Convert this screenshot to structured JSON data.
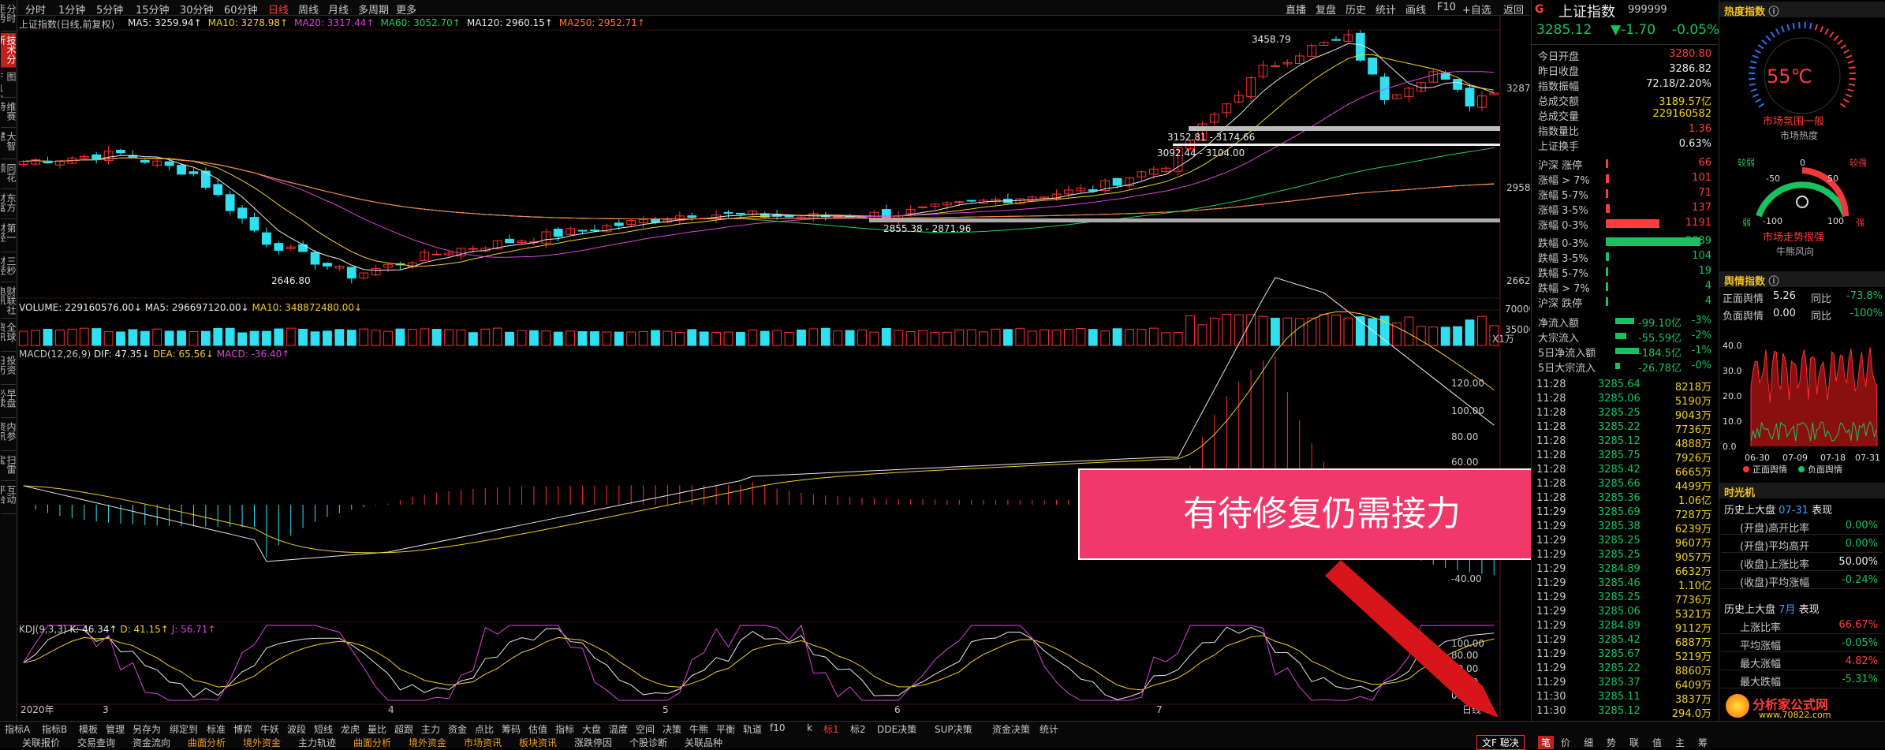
{
  "topbar": {
    "periods": [
      "分时",
      "1分钟",
      "5分钟",
      "15分钟",
      "30分钟",
      "60分钟",
      "日线",
      "周线",
      "月线",
      "多周期",
      "更多"
    ],
    "active": "日线",
    "right": [
      "直播",
      "复盘",
      "历史",
      "统计",
      "画线",
      "F10",
      "+自选",
      "返回"
    ]
  },
  "leftbar": {
    "tabs": [
      "分时走势",
      "技术分析",
      "图F10",
      "维赛特",
      "大智慧",
      "同花顺",
      "东方财富",
      "第一财经",
      "三秒财经",
      "财联社电讯",
      "全球资讯",
      "投资日历",
      "早盘必读",
      "内参资讯",
      "扫雷宝",
      "互动平台"
    ],
    "active": "技术分析"
  },
  "main": {
    "title": "上证指数(日线,前复权)",
    "ma": [
      {
        "t": "MA5: 3259.94↑",
        "c": "#e8e8e8"
      },
      {
        "t": "MA10: 3278.98↑",
        "c": "#f0d020"
      },
      {
        "t": "MA20: 3317.44↑",
        "c": "#e040e0"
      },
      {
        "t": "MA60: 3052.70↑",
        "c": "#20d060"
      },
      {
        "t": "MA120: 2960.15↑",
        "c": "#e8e8e8"
      },
      {
        "t": "MA250: 2952.71↑",
        "c": "#ff7a30"
      }
    ],
    "price_axis": [
      "3287",
      "2958",
      "2662"
    ],
    "annot": {
      "high": "3458.79",
      "low": "2646.80",
      "zone1": "3152.81 - 3174.66",
      "zone2": "3092.44 - 3104.00",
      "zone3": "2855.38 - 2871.96"
    },
    "volume": {
      "label": "VOLUME: 229160576.00↓",
      "ma5": "MA5: 296697120.00↓",
      "ma10": "MA10: 348872480.00↓",
      "axis": [
        "70000",
        "35000",
        "X1万"
      ]
    },
    "macd": {
      "label": "MACD(12,26,9)",
      "dif": "DIF: 47.35↓",
      "dea": "DEA: 65.56↓",
      "macd": "MACD: -36.40↑",
      "axis": [
        "120.00",
        "100.00",
        "80.00",
        "60.00",
        "-40.00"
      ]
    },
    "kdj": {
      "label": "KDJ(9,3,3)",
      "k": "K: 46.34↑",
      "d": "D: 41.15↑",
      "j": "J: 56.71↑",
      "axis": [
        "100.00",
        "80.00",
        "50.00",
        "20.00",
        "0.00"
      ]
    },
    "date_axis": [
      "2020年",
      "3",
      "4",
      "5",
      "6",
      "7"
    ],
    "date_right": "日线"
  },
  "banner": "有待修复仍需接力",
  "quote": {
    "mark": "G",
    "name": "上证指数",
    "code": "999999",
    "price": "3285.12",
    "change": "▼-1.70",
    "pct": "-0.05%"
  },
  "stats": [
    {
      "l": "今日开盘",
      "v": "3280.80",
      "c": "red"
    },
    {
      "l": "昨日收盘",
      "v": "3286.82",
      "c": "wht"
    },
    {
      "l": "指数振幅",
      "v": "72.18/2.20%",
      "c": "wht"
    },
    {
      "l": "总成交额",
      "v": "3189.57亿",
      "c": "yel"
    },
    {
      "l": "总成交量",
      "v": "229160582",
      "c": "yel"
    },
    {
      "l": "指数量比",
      "v": "1.36",
      "c": "red"
    },
    {
      "l": "上证换手",
      "v": "0.63%",
      "c": "wht"
    }
  ],
  "updown": [
    {
      "l": "沪深 涨停",
      "v": "66",
      "c": "red",
      "w": 0
    },
    {
      "l": "涨幅 > 7%",
      "v": "101",
      "c": "red",
      "w": 3
    },
    {
      "l": "涨幅 5-7%",
      "v": "71",
      "c": "red",
      "w": 2
    },
    {
      "l": "涨幅 3-5%",
      "v": "137",
      "c": "red",
      "w": 4
    },
    {
      "l": "涨幅 0-3%",
      "v": "1191",
      "c": "red",
      "w": 50
    },
    {
      "l": "跌幅 0-3%",
      "v": "2089",
      "c": "green",
      "w": 88
    },
    {
      "l": "跌幅 3-5%",
      "v": "104",
      "c": "green",
      "w": 3
    },
    {
      "l": "跌幅 5-7%",
      "v": "19",
      "c": "green",
      "w": 1
    },
    {
      "l": "跌幅 > 7%",
      "v": "4",
      "c": "green",
      "w": 1
    },
    {
      "l": "沪深 跌停",
      "v": "4",
      "c": "green",
      "w": 0
    }
  ],
  "flows": [
    {
      "l": "净流入额",
      "v": "-99.10亿",
      "p": "-3%"
    },
    {
      "l": "大宗流入",
      "v": "-55.59亿",
      "p": "-2%"
    },
    {
      "l": "5日净流入额",
      "v": "-184.5亿",
      "p": "-1%"
    },
    {
      "l": "5日大宗流入",
      "v": "-26.78亿",
      "p": "-0%"
    }
  ],
  "ticks": [
    [
      "11:28",
      "3285.64",
      "8218万"
    ],
    [
      "11:28",
      "3285.06",
      "5190万"
    ],
    [
      "11:28",
      "3285.25",
      "9043万"
    ],
    [
      "11:28",
      "3285.22",
      "7736万"
    ],
    [
      "11:28",
      "3285.12",
      "4888万"
    ],
    [
      "11:28",
      "3285.75",
      "7926万"
    ],
    [
      "11:28",
      "3285.42",
      "6665万"
    ],
    [
      "11:28",
      "3285.66",
      "4499万"
    ],
    [
      "11:28",
      "3285.36",
      "1.06亿"
    ],
    [
      "11:29",
      "3285.69",
      "7287万"
    ],
    [
      "11:29",
      "3285.38",
      "6239万"
    ],
    [
      "11:29",
      "3285.25",
      "9607万"
    ],
    [
      "11:29",
      "3285.25",
      "9057万"
    ],
    [
      "11:29",
      "3284.89",
      "6632万"
    ],
    [
      "11:29",
      "3285.46",
      "1.10亿"
    ],
    [
      "11:29",
      "3285.25",
      "7736万"
    ],
    [
      "11:29",
      "3285.06",
      "5321万"
    ],
    [
      "11:29",
      "3284.89",
      "9112万"
    ],
    [
      "11:29",
      "3285.42",
      "6887万"
    ],
    [
      "11:29",
      "3285.67",
      "5219万"
    ],
    [
      "11:29",
      "3285.22",
      "8860万"
    ],
    [
      "11:29",
      "3285.37",
      "6409万"
    ],
    [
      "11:30",
      "3285.11",
      "3837万"
    ],
    [
      "11:30",
      "3285.12",
      "294.0万"
    ]
  ],
  "heat": {
    "title": "热度指数",
    "temp": "55℃",
    "label1": "市场氛围一般",
    "label2": "市场热度",
    "g2": {
      "ticks": [
        "0",
        "-50",
        "50",
        "-100",
        "100"
      ],
      "weak": "较弱",
      "strong": "较强",
      "w2": "弱",
      "s2": "强",
      "label1": "市场走势很强",
      "label2": "牛熊风向"
    }
  },
  "opinion": {
    "title": "舆情指数",
    "pos_l": "正面舆情",
    "pos_v": "5.26",
    "pos_cl": "同比",
    "pos_c": "-73.8%",
    "neg_l": "负面舆情",
    "neg_v": "0.00",
    "neg_cl": "同比",
    "neg_c": "-100%",
    "yaxis": [
      "40.0",
      "30.0",
      "20.0",
      "10.0",
      "0.0"
    ],
    "dates": [
      "06-30",
      "07-09",
      "07-18",
      "07-31"
    ],
    "leg1": "正面舆情",
    "leg2": "负面舆情"
  },
  "time_machine": {
    "title": "时光机",
    "h1": "历史上大盘",
    "h1d": "07-31",
    "h1s": "表现",
    "rows1": [
      {
        "l": "(开盘)高开比率",
        "v": "0.00%",
        "c": "green"
      },
      {
        "l": "(开盘)平均高开",
        "v": "0.00%",
        "c": "green"
      },
      {
        "l": "(收盘)上涨比率",
        "v": "50.00%",
        "c": "wht"
      },
      {
        "l": "(收盘)平均涨幅",
        "v": "-0.24%",
        "c": "green"
      }
    ],
    "h2": "历史上大盘",
    "h2d": "7月",
    "h2s": "表现",
    "rows2": [
      {
        "l": "上涨比率",
        "v": "66.67%",
        "c": "red"
      },
      {
        "l": "平均涨幅",
        "v": "-0.05%",
        "c": "green"
      },
      {
        "l": "最大涨幅",
        "v": "4.82%",
        "c": "red"
      },
      {
        "l": "最大跌幅",
        "v": "-5.31%",
        "c": "green"
      }
    ]
  },
  "logo": {
    "name": "分析家公式网",
    "url": "www.70822.com"
  },
  "bottom": {
    "row1": [
      "指标A",
      "指标B",
      "模板",
      "管理",
      "另存为",
      "绑定到",
      "标准",
      "博弈",
      "牛妖",
      "波段",
      "短线",
      "龙虎",
      "量比",
      "超跟",
      "主力",
      "资金",
      "点比",
      "筹码",
      "估值",
      "指标",
      "大盘",
      "温度",
      "空间",
      "决策",
      "牛熊",
      "平衡",
      "轨道",
      "f10",
      "k",
      "标1",
      "标2",
      "DDE决策",
      "SUP决策",
      "资金决策",
      "统计"
    ],
    "row2": [
      "关联报价",
      "交易查询",
      "资金流向",
      "曲面分析",
      "境外资金",
      "主力轨迹",
      "曲面分析",
      "境外资金",
      "市场资讯",
      "板块资讯",
      "涨跌停因",
      "个股诊断",
      "关联品种"
    ],
    "rightbtn": "文F 聪决",
    "tabs": [
      "笔",
      "价",
      "细",
      "势",
      "联",
      "值",
      "主",
      "筹"
    ]
  }
}
